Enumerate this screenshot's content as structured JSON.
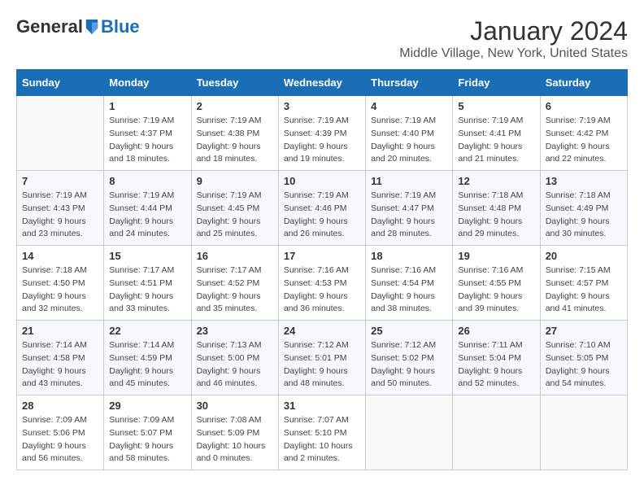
{
  "header": {
    "logo": {
      "general": "General",
      "blue": "Blue"
    },
    "title": "January 2024",
    "subtitle": "Middle Village, New York, United States"
  },
  "days_of_week": [
    "Sunday",
    "Monday",
    "Tuesday",
    "Wednesday",
    "Thursday",
    "Friday",
    "Saturday"
  ],
  "weeks": [
    [
      {
        "day": "",
        "info": ""
      },
      {
        "day": "1",
        "info": "Sunrise: 7:19 AM\nSunset: 4:37 PM\nDaylight: 9 hours\nand 18 minutes."
      },
      {
        "day": "2",
        "info": "Sunrise: 7:19 AM\nSunset: 4:38 PM\nDaylight: 9 hours\nand 18 minutes."
      },
      {
        "day": "3",
        "info": "Sunrise: 7:19 AM\nSunset: 4:39 PM\nDaylight: 9 hours\nand 19 minutes."
      },
      {
        "day": "4",
        "info": "Sunrise: 7:19 AM\nSunset: 4:40 PM\nDaylight: 9 hours\nand 20 minutes."
      },
      {
        "day": "5",
        "info": "Sunrise: 7:19 AM\nSunset: 4:41 PM\nDaylight: 9 hours\nand 21 minutes."
      },
      {
        "day": "6",
        "info": "Sunrise: 7:19 AM\nSunset: 4:42 PM\nDaylight: 9 hours\nand 22 minutes."
      }
    ],
    [
      {
        "day": "7",
        "info": "Sunrise: 7:19 AM\nSunset: 4:43 PM\nDaylight: 9 hours\nand 23 minutes."
      },
      {
        "day": "8",
        "info": "Sunrise: 7:19 AM\nSunset: 4:44 PM\nDaylight: 9 hours\nand 24 minutes."
      },
      {
        "day": "9",
        "info": "Sunrise: 7:19 AM\nSunset: 4:45 PM\nDaylight: 9 hours\nand 25 minutes."
      },
      {
        "day": "10",
        "info": "Sunrise: 7:19 AM\nSunset: 4:46 PM\nDaylight: 9 hours\nand 26 minutes."
      },
      {
        "day": "11",
        "info": "Sunrise: 7:19 AM\nSunset: 4:47 PM\nDaylight: 9 hours\nand 28 minutes."
      },
      {
        "day": "12",
        "info": "Sunrise: 7:18 AM\nSunset: 4:48 PM\nDaylight: 9 hours\nand 29 minutes."
      },
      {
        "day": "13",
        "info": "Sunrise: 7:18 AM\nSunset: 4:49 PM\nDaylight: 9 hours\nand 30 minutes."
      }
    ],
    [
      {
        "day": "14",
        "info": "Sunrise: 7:18 AM\nSunset: 4:50 PM\nDaylight: 9 hours\nand 32 minutes."
      },
      {
        "day": "15",
        "info": "Sunrise: 7:17 AM\nSunset: 4:51 PM\nDaylight: 9 hours\nand 33 minutes."
      },
      {
        "day": "16",
        "info": "Sunrise: 7:17 AM\nSunset: 4:52 PM\nDaylight: 9 hours\nand 35 minutes."
      },
      {
        "day": "17",
        "info": "Sunrise: 7:16 AM\nSunset: 4:53 PM\nDaylight: 9 hours\nand 36 minutes."
      },
      {
        "day": "18",
        "info": "Sunrise: 7:16 AM\nSunset: 4:54 PM\nDaylight: 9 hours\nand 38 minutes."
      },
      {
        "day": "19",
        "info": "Sunrise: 7:16 AM\nSunset: 4:55 PM\nDaylight: 9 hours\nand 39 minutes."
      },
      {
        "day": "20",
        "info": "Sunrise: 7:15 AM\nSunset: 4:57 PM\nDaylight: 9 hours\nand 41 minutes."
      }
    ],
    [
      {
        "day": "21",
        "info": "Sunrise: 7:14 AM\nSunset: 4:58 PM\nDaylight: 9 hours\nand 43 minutes."
      },
      {
        "day": "22",
        "info": "Sunrise: 7:14 AM\nSunset: 4:59 PM\nDaylight: 9 hours\nand 45 minutes."
      },
      {
        "day": "23",
        "info": "Sunrise: 7:13 AM\nSunset: 5:00 PM\nDaylight: 9 hours\nand 46 minutes."
      },
      {
        "day": "24",
        "info": "Sunrise: 7:12 AM\nSunset: 5:01 PM\nDaylight: 9 hours\nand 48 minutes."
      },
      {
        "day": "25",
        "info": "Sunrise: 7:12 AM\nSunset: 5:02 PM\nDaylight: 9 hours\nand 50 minutes."
      },
      {
        "day": "26",
        "info": "Sunrise: 7:11 AM\nSunset: 5:04 PM\nDaylight: 9 hours\nand 52 minutes."
      },
      {
        "day": "27",
        "info": "Sunrise: 7:10 AM\nSunset: 5:05 PM\nDaylight: 9 hours\nand 54 minutes."
      }
    ],
    [
      {
        "day": "28",
        "info": "Sunrise: 7:09 AM\nSunset: 5:06 PM\nDaylight: 9 hours\nand 56 minutes."
      },
      {
        "day": "29",
        "info": "Sunrise: 7:09 AM\nSunset: 5:07 PM\nDaylight: 9 hours\nand 58 minutes."
      },
      {
        "day": "30",
        "info": "Sunrise: 7:08 AM\nSunset: 5:09 PM\nDaylight: 10 hours\nand 0 minutes."
      },
      {
        "day": "31",
        "info": "Sunrise: 7:07 AM\nSunset: 5:10 PM\nDaylight: 10 hours\nand 2 minutes."
      },
      {
        "day": "",
        "info": ""
      },
      {
        "day": "",
        "info": ""
      },
      {
        "day": "",
        "info": ""
      }
    ]
  ]
}
